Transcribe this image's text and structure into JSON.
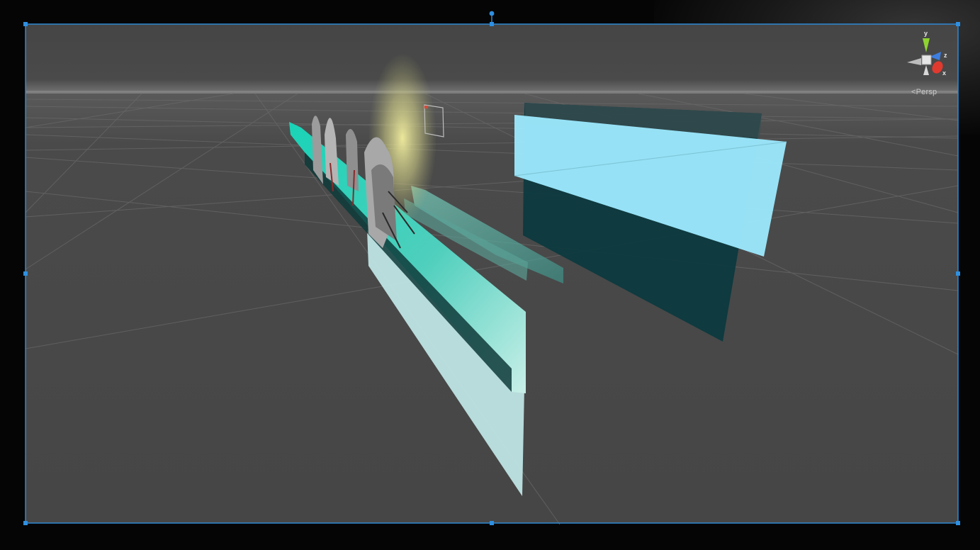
{
  "scene_view": {
    "projection_label": "Persp",
    "gizmo": {
      "axis_y": "y",
      "axis_z": "z",
      "axis_x": "x"
    }
  },
  "colors": {
    "viewport_bg": "#474747",
    "selection_outline": "#2f8fe0",
    "gizmo_y": "#8fd430",
    "gizmo_z": "#3d7ee0",
    "gizmo_x": "#e03a2f"
  }
}
